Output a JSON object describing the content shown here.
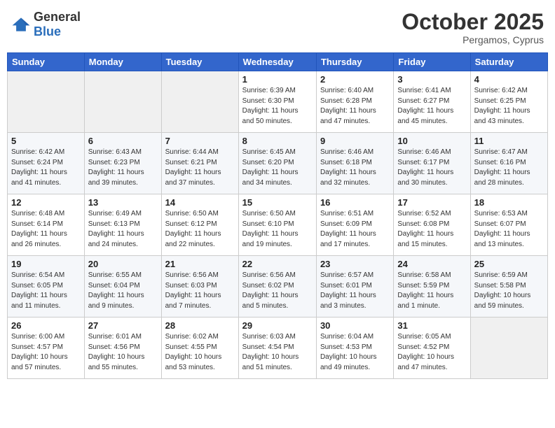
{
  "header": {
    "logo_general": "General",
    "logo_blue": "Blue",
    "month": "October 2025",
    "location": "Pergamos, Cyprus"
  },
  "weekdays": [
    "Sunday",
    "Monday",
    "Tuesday",
    "Wednesday",
    "Thursday",
    "Friday",
    "Saturday"
  ],
  "weeks": [
    [
      {
        "day": "",
        "info": ""
      },
      {
        "day": "",
        "info": ""
      },
      {
        "day": "",
        "info": ""
      },
      {
        "day": "1",
        "info": "Sunrise: 6:39 AM\nSunset: 6:30 PM\nDaylight: 11 hours\nand 50 minutes."
      },
      {
        "day": "2",
        "info": "Sunrise: 6:40 AM\nSunset: 6:28 PM\nDaylight: 11 hours\nand 47 minutes."
      },
      {
        "day": "3",
        "info": "Sunrise: 6:41 AM\nSunset: 6:27 PM\nDaylight: 11 hours\nand 45 minutes."
      },
      {
        "day": "4",
        "info": "Sunrise: 6:42 AM\nSunset: 6:25 PM\nDaylight: 11 hours\nand 43 minutes."
      }
    ],
    [
      {
        "day": "5",
        "info": "Sunrise: 6:42 AM\nSunset: 6:24 PM\nDaylight: 11 hours\nand 41 minutes."
      },
      {
        "day": "6",
        "info": "Sunrise: 6:43 AM\nSunset: 6:23 PM\nDaylight: 11 hours\nand 39 minutes."
      },
      {
        "day": "7",
        "info": "Sunrise: 6:44 AM\nSunset: 6:21 PM\nDaylight: 11 hours\nand 37 minutes."
      },
      {
        "day": "8",
        "info": "Sunrise: 6:45 AM\nSunset: 6:20 PM\nDaylight: 11 hours\nand 34 minutes."
      },
      {
        "day": "9",
        "info": "Sunrise: 6:46 AM\nSunset: 6:18 PM\nDaylight: 11 hours\nand 32 minutes."
      },
      {
        "day": "10",
        "info": "Sunrise: 6:46 AM\nSunset: 6:17 PM\nDaylight: 11 hours\nand 30 minutes."
      },
      {
        "day": "11",
        "info": "Sunrise: 6:47 AM\nSunset: 6:16 PM\nDaylight: 11 hours\nand 28 minutes."
      }
    ],
    [
      {
        "day": "12",
        "info": "Sunrise: 6:48 AM\nSunset: 6:14 PM\nDaylight: 11 hours\nand 26 minutes."
      },
      {
        "day": "13",
        "info": "Sunrise: 6:49 AM\nSunset: 6:13 PM\nDaylight: 11 hours\nand 24 minutes."
      },
      {
        "day": "14",
        "info": "Sunrise: 6:50 AM\nSunset: 6:12 PM\nDaylight: 11 hours\nand 22 minutes."
      },
      {
        "day": "15",
        "info": "Sunrise: 6:50 AM\nSunset: 6:10 PM\nDaylight: 11 hours\nand 19 minutes."
      },
      {
        "day": "16",
        "info": "Sunrise: 6:51 AM\nSunset: 6:09 PM\nDaylight: 11 hours\nand 17 minutes."
      },
      {
        "day": "17",
        "info": "Sunrise: 6:52 AM\nSunset: 6:08 PM\nDaylight: 11 hours\nand 15 minutes."
      },
      {
        "day": "18",
        "info": "Sunrise: 6:53 AM\nSunset: 6:07 PM\nDaylight: 11 hours\nand 13 minutes."
      }
    ],
    [
      {
        "day": "19",
        "info": "Sunrise: 6:54 AM\nSunset: 6:05 PM\nDaylight: 11 hours\nand 11 minutes."
      },
      {
        "day": "20",
        "info": "Sunrise: 6:55 AM\nSunset: 6:04 PM\nDaylight: 11 hours\nand 9 minutes."
      },
      {
        "day": "21",
        "info": "Sunrise: 6:56 AM\nSunset: 6:03 PM\nDaylight: 11 hours\nand 7 minutes."
      },
      {
        "day": "22",
        "info": "Sunrise: 6:56 AM\nSunset: 6:02 PM\nDaylight: 11 hours\nand 5 minutes."
      },
      {
        "day": "23",
        "info": "Sunrise: 6:57 AM\nSunset: 6:01 PM\nDaylight: 11 hours\nand 3 minutes."
      },
      {
        "day": "24",
        "info": "Sunrise: 6:58 AM\nSunset: 5:59 PM\nDaylight: 11 hours\nand 1 minute."
      },
      {
        "day": "25",
        "info": "Sunrise: 6:59 AM\nSunset: 5:58 PM\nDaylight: 10 hours\nand 59 minutes."
      }
    ],
    [
      {
        "day": "26",
        "info": "Sunrise: 6:00 AM\nSunset: 4:57 PM\nDaylight: 10 hours\nand 57 minutes."
      },
      {
        "day": "27",
        "info": "Sunrise: 6:01 AM\nSunset: 4:56 PM\nDaylight: 10 hours\nand 55 minutes."
      },
      {
        "day": "28",
        "info": "Sunrise: 6:02 AM\nSunset: 4:55 PM\nDaylight: 10 hours\nand 53 minutes."
      },
      {
        "day": "29",
        "info": "Sunrise: 6:03 AM\nSunset: 4:54 PM\nDaylight: 10 hours\nand 51 minutes."
      },
      {
        "day": "30",
        "info": "Sunrise: 6:04 AM\nSunset: 4:53 PM\nDaylight: 10 hours\nand 49 minutes."
      },
      {
        "day": "31",
        "info": "Sunrise: 6:05 AM\nSunset: 4:52 PM\nDaylight: 10 hours\nand 47 minutes."
      },
      {
        "day": "",
        "info": ""
      }
    ]
  ]
}
